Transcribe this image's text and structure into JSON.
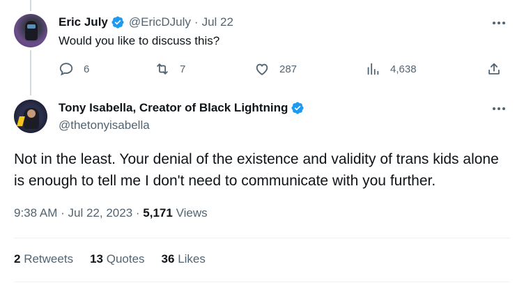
{
  "reply_tweet": {
    "author_name": "Eric July",
    "handle": "@EricDJuly",
    "date": "Jul 22",
    "text": "Would you like to discuss this?",
    "stats": {
      "replies": "6",
      "retweets": "7",
      "likes": "287",
      "views": "4,638"
    }
  },
  "main_tweet": {
    "author_name": "Tony Isabella, Creator of Black Lightning",
    "handle": "@thetonyisabella",
    "text": "Not in the least. Your denial of the existence and validity of trans kids alone is enough to tell me I don't need to communicate with you further.",
    "time": "9:38 AM",
    "date": "Jul 22, 2023",
    "views_count": "5,171",
    "views_label": "Views",
    "engagement": {
      "retweets_count": "2",
      "retweets_label": "Retweets",
      "quotes_count": "13",
      "quotes_label": "Quotes",
      "likes_count": "36",
      "likes_label": "Likes"
    }
  },
  "colors": {
    "verified_blue": "#1d9bf0",
    "secondary_text": "#536471",
    "primary_text": "#0f1419"
  },
  "separators": {
    "dot": "·"
  }
}
